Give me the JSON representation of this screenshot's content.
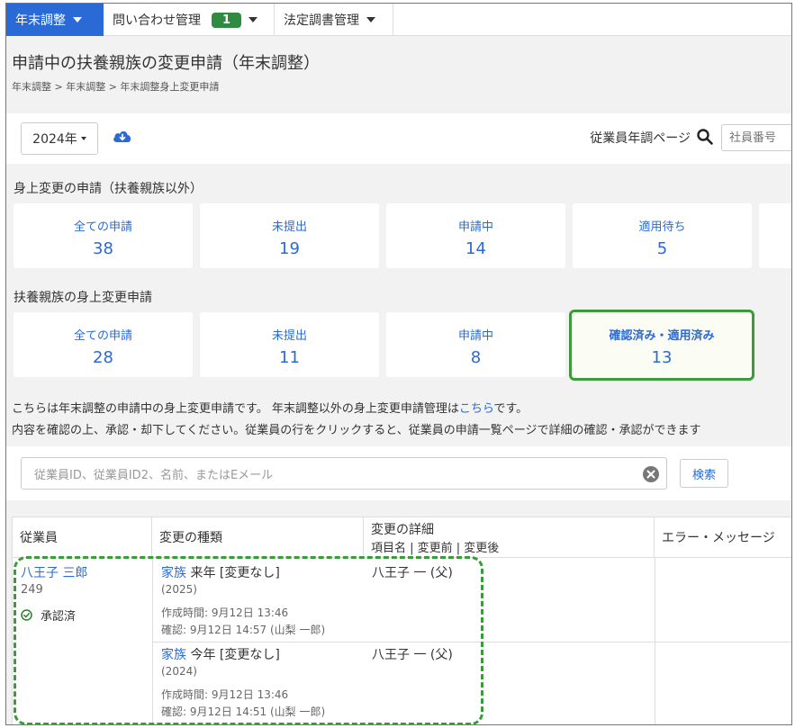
{
  "nav": {
    "items": [
      {
        "label": "年末調整"
      },
      {
        "label": "問い合わせ管理",
        "badge": "1"
      },
      {
        "label": "法定調書管理"
      }
    ]
  },
  "page": {
    "title": "申請中の扶養親族の変更申請（年末調整）",
    "breadcrumb": "年末調整 > 年末調整 > 年末調整身上変更申請"
  },
  "toolbar": {
    "year": "2024年",
    "download_icon": "cloud-download-icon",
    "employee_page_label": "従業員年調ページ",
    "employee_number_placeholder": "社員番号"
  },
  "section_non_dependent": {
    "title": "身上変更の申請（扶養親族以外）",
    "cards": [
      {
        "label": "全ての申請",
        "value": "38"
      },
      {
        "label": "未提出",
        "value": "19"
      },
      {
        "label": "申請中",
        "value": "14"
      },
      {
        "label": "適用待ち",
        "value": "5"
      }
    ]
  },
  "section_dependent": {
    "title": "扶養親族の身上変更申請",
    "cards": [
      {
        "label": "全ての申請",
        "value": "28"
      },
      {
        "label": "未提出",
        "value": "11"
      },
      {
        "label": "申請中",
        "value": "8"
      },
      {
        "label": "確認済み・適用済み",
        "value": "13"
      }
    ]
  },
  "info": {
    "line1_prefix": "こちらは年末調整の申請中の身上変更申請です。 年末調整以外の身上変更申請管理は",
    "line1_link": "こちら",
    "line1_suffix": "です。",
    "line2": "内容を確認の上、承認・却下してください。従業員の行をクリックすると、従業員の申請一覧ページで詳細の確認・承認ができます"
  },
  "search": {
    "placeholder": "従業員ID、従業員ID2、名前、またはEメール",
    "button": "検索"
  },
  "table": {
    "headers": {
      "employee": "従業員",
      "change_type": "変更の種類",
      "details": "変更の詳細",
      "details_sub": "項目名 | 変更前 | 変更後",
      "error": "エラー・メッセージ"
    },
    "employee": {
      "name": "八王子 三郎",
      "id": "249",
      "status": "承認済"
    },
    "rows": [
      {
        "kind_link": "家族",
        "kind_text": " 来年 [変更なし]",
        "year": "(2025)",
        "created": "作成時間: 9月12日 13:46",
        "confirmed": "確認: 9月12日 14:57 (山梨 一郎)",
        "detail": "八王子 一 (父)"
      },
      {
        "kind_link": "家族",
        "kind_text": " 今年 [変更なし]",
        "year": "(2024)",
        "created": "作成時間: 9月12日 13:46",
        "confirmed": "確認: 9月12日 14:51 (山梨 一郎)",
        "detail": "八王子 一 (父)"
      }
    ]
  },
  "colors": {
    "primary": "#2a6ad6",
    "badge_green": "#2e8b3f",
    "highlight_green": "#3b9a3b"
  }
}
